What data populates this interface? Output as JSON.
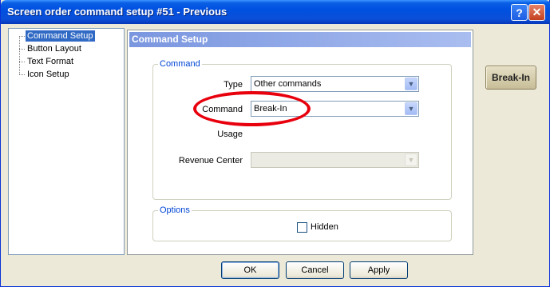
{
  "window": {
    "title": "Screen order command setup #51 - Previous",
    "help_glyph": "?",
    "close_glyph": "✕"
  },
  "tree": {
    "items": [
      {
        "label": "Command Setup",
        "selected": true
      },
      {
        "label": "Button Layout",
        "selected": false
      },
      {
        "label": "Text Format",
        "selected": false
      },
      {
        "label": "Icon Setup",
        "selected": false
      }
    ]
  },
  "panel": {
    "header": "Command Setup",
    "command_group": {
      "legend": "Command",
      "type_label": "Type",
      "type_value": "Other commands",
      "command_label": "Command",
      "command_value": "Break-In",
      "usage_label": "Usage",
      "revenue_label": "Revenue Center",
      "revenue_value": ""
    },
    "options_group": {
      "legend": "Options",
      "hidden_label": "Hidden",
      "hidden_checked": false
    }
  },
  "preview_button": {
    "label": "Break-In"
  },
  "footer": {
    "ok_label": "OK",
    "cancel_label": "Cancel",
    "apply_label": "Apply"
  },
  "icons": {
    "combo_arrow": "▼"
  },
  "colors": {
    "title_bar": "#0050e0",
    "selection": "#316ac5",
    "annotation": "#e8000d",
    "group_legend": "#0046d5"
  }
}
